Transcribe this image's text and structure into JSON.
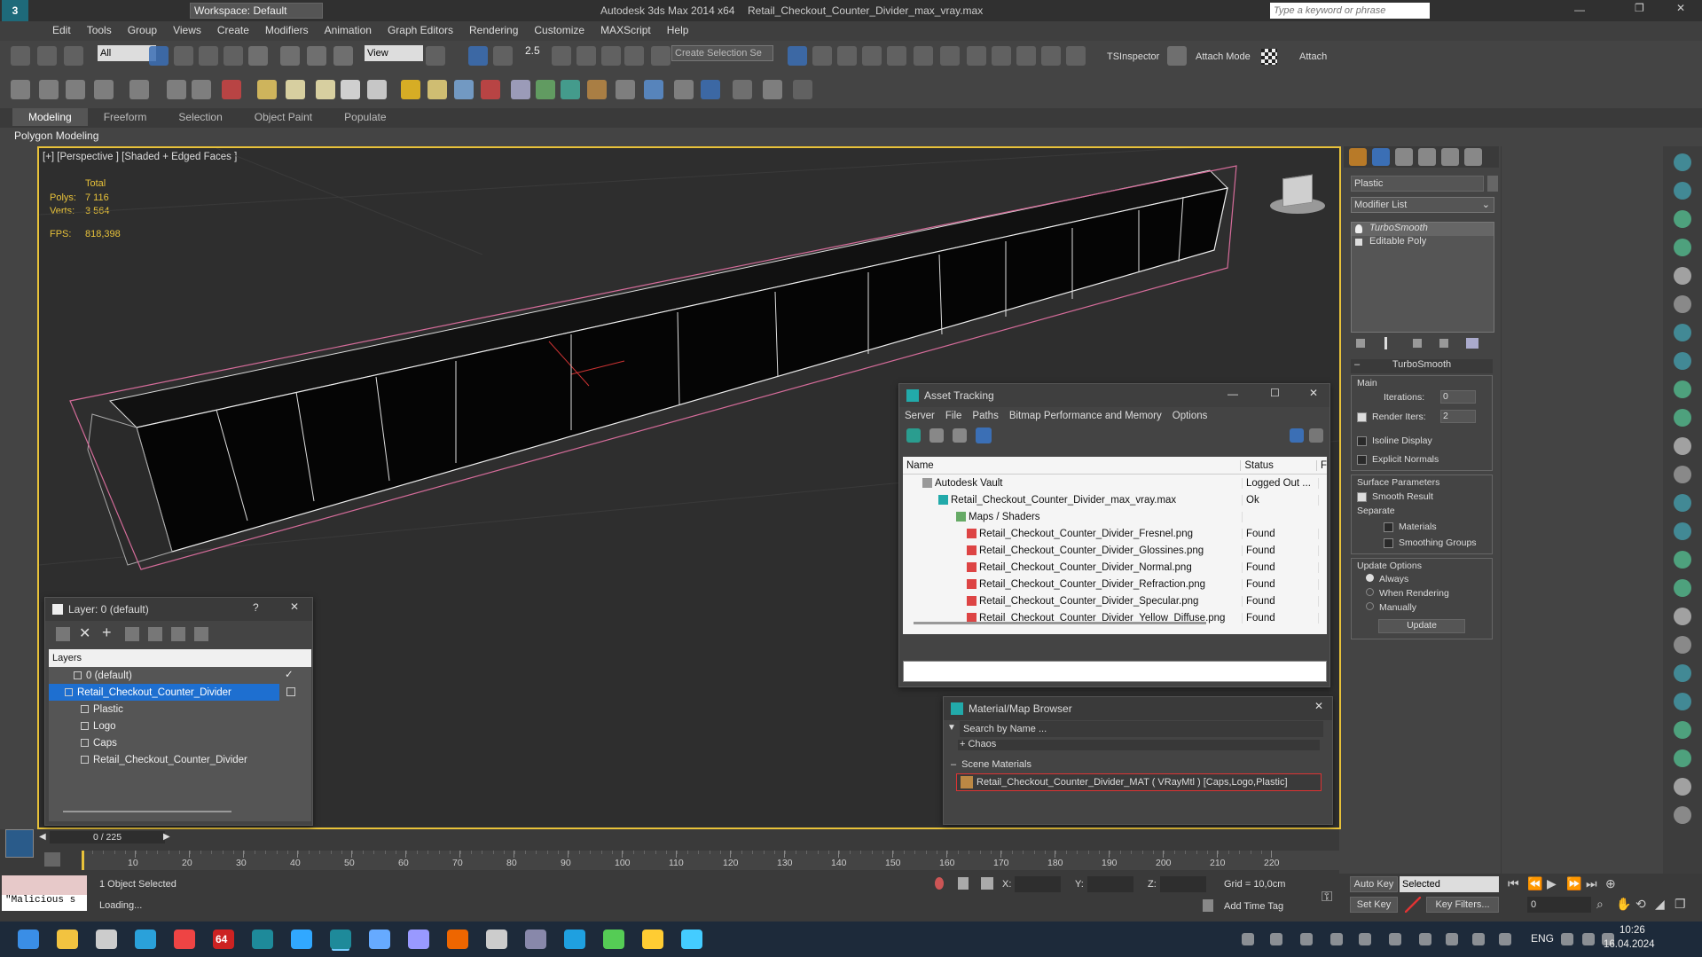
{
  "title": {
    "workspace": "Workspace: Default",
    "app": "Autodesk 3ds Max  2014 x64",
    "file": "Retail_Checkout_Counter_Divider_max_vray.max",
    "search_placeholder": "Type a keyword or phrase"
  },
  "menu": [
    "Edit",
    "Tools",
    "Group",
    "Views",
    "Create",
    "Modifiers",
    "Animation",
    "Graph Editors",
    "Rendering",
    "Customize",
    "MAXScript",
    "Help"
  ],
  "toolbar": {
    "filter": "All",
    "refcoord": "View",
    "snap_val": "2.5",
    "selection_set": "Create Selection Se",
    "tsinspector": "TSInspector",
    "attach_mode": "Attach Mode",
    "attach": "Attach"
  },
  "ribbon": {
    "tabs": [
      "Modeling",
      "Freeform",
      "Selection",
      "Object Paint",
      "Populate"
    ],
    "sub": "Polygon Modeling"
  },
  "viewport": {
    "label": "[+] [Perspective ] [Shaded + Edged Faces ]",
    "stats_header": "Total",
    "polys_label": "Polys:",
    "polys": "7 116",
    "verts_label": "Verts:",
    "verts": "3 564",
    "fps_label": "FPS:",
    "fps": "818,398"
  },
  "cmdpanel": {
    "object_name": "Plastic",
    "modifier_list": "Modifier List",
    "stack": [
      "TurboSmooth",
      "Editable Poly"
    ],
    "rollout": "TurboSmooth",
    "main": "Main",
    "iterations_label": "Iterations:",
    "iterations": "0",
    "render_iters_label": "Render Iters:",
    "render_iters": "2",
    "isoline": "Isoline Display",
    "explicit": "Explicit Normals",
    "surface": "Surface Parameters",
    "smooth_result": "Smooth Result",
    "separate": "Separate",
    "materials": "Materials",
    "smoothing_groups": "Smoothing Groups",
    "update_options": "Update Options",
    "always": "Always",
    "when_rendering": "When Rendering",
    "manually": "Manually",
    "update": "Update"
  },
  "asset_tracking": {
    "title": "Asset Tracking",
    "menu": [
      "Server",
      "File",
      "Paths",
      "Bitmap Performance and Memory",
      "Options"
    ],
    "col_name": "Name",
    "col_status": "Status",
    "col_extra": "F",
    "rows": [
      {
        "name": "Autodesk Vault",
        "status": "Logged Out ..."
      },
      {
        "name": "Retail_Checkout_Counter_Divider_max_vray.max",
        "status": "Ok"
      },
      {
        "name": "Maps / Shaders",
        "status": ""
      },
      {
        "name": "Retail_Checkout_Counter_Divider_Fresnel.png",
        "status": "Found"
      },
      {
        "name": "Retail_Checkout_Counter_Divider_Glossines.png",
        "status": "Found"
      },
      {
        "name": "Retail_Checkout_Counter_Divider_Normal.png",
        "status": "Found"
      },
      {
        "name": "Retail_Checkout_Counter_Divider_Refraction.png",
        "status": "Found"
      },
      {
        "name": "Retail_Checkout_Counter_Divider_Specular.png",
        "status": "Found"
      },
      {
        "name": "Retail_Checkout_Counter_Divider_Yellow_Diffuse.png",
        "status": "Found"
      }
    ]
  },
  "layer": {
    "title": "Layer: 0 (default)",
    "header": "Layers",
    "items": [
      "0 (default)",
      "Retail_Checkout_Counter_Divider",
      "Plastic",
      "Logo",
      "Caps",
      "Retail_Checkout_Counter_Divider"
    ]
  },
  "mat_browser": {
    "title": "Material/Map Browser",
    "search": "Search by Name ...",
    "chaos": "+ Chaos",
    "scene": "Scene Materials",
    "material": "Retail_Checkout_Counter_Divider_MAT ( VRayMtl ) [Caps,Logo,Plastic]"
  },
  "timeline": {
    "frame": "0 / 225",
    "ticks": [
      "10",
      "20",
      "30",
      "40",
      "50",
      "60",
      "70",
      "80",
      "90",
      "100",
      "110",
      "120",
      "130",
      "140",
      "150",
      "160",
      "170",
      "180",
      "190",
      "200",
      "210",
      "220"
    ]
  },
  "status": {
    "selected": "1 Object Selected",
    "loading": "Loading...",
    "script": "\"Malicious s",
    "x": "X:",
    "y": "Y:",
    "z": "Z:",
    "grid": "Grid = 10,0cm",
    "add_time_tag": "Add Time Tag",
    "auto_key": "Auto Key",
    "selected_dd": "Selected",
    "set_key": "Set Key",
    "key_filters": "Key Filters...",
    "frame_val": "0"
  },
  "taskbar": {
    "lang": "ENG",
    "time": "10:26",
    "date": "16.04.2024",
    "badge": "64"
  }
}
